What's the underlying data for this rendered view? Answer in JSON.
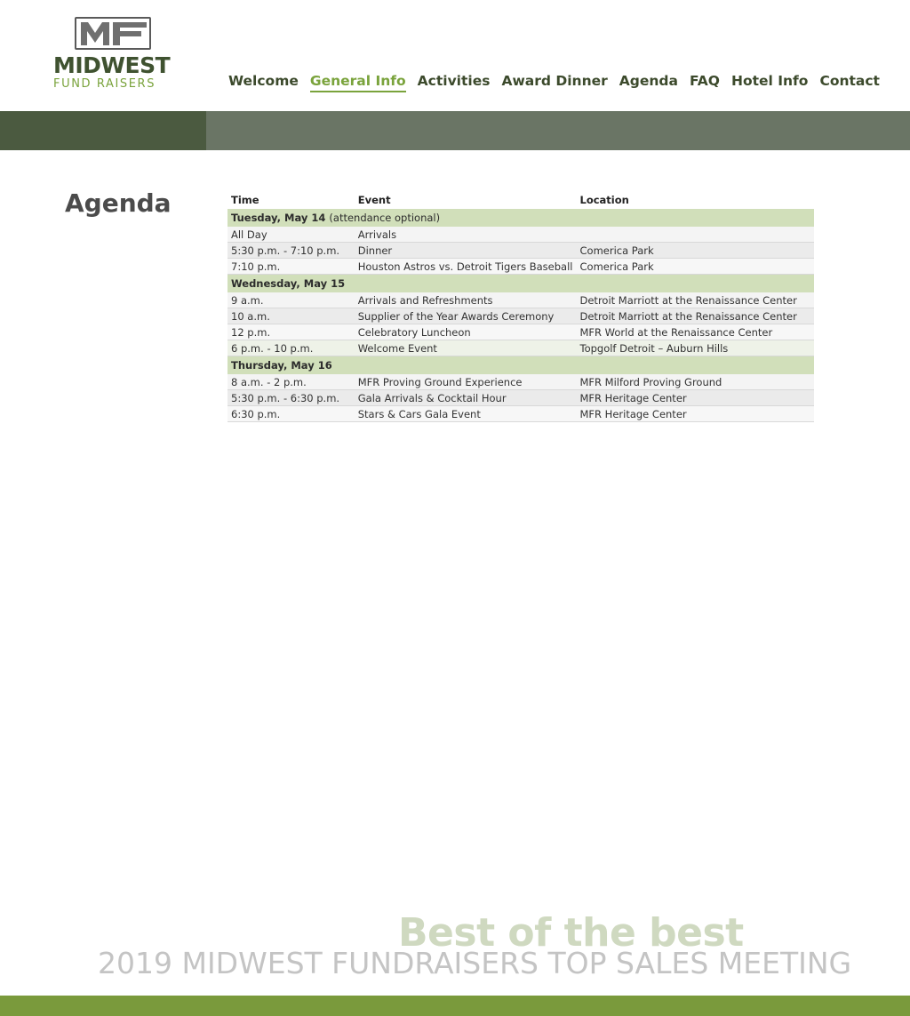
{
  "brand": {
    "mark": "MF",
    "name": "MIDWEST",
    "sub": "FUND RAISERS",
    "colors": {
      "primary": "#3f5230",
      "accent": "#7aa33c",
      "band_dark": "#4b5a40",
      "band_light": "#6a7565",
      "footer": "#7a9a3c",
      "day_row": "#d1dfba"
    }
  },
  "nav": [
    {
      "label": "Welcome",
      "active": false
    },
    {
      "label": "General Info",
      "active": true
    },
    {
      "label": "Activities",
      "active": false
    },
    {
      "label": "Award Dinner",
      "active": false
    },
    {
      "label": "Agenda",
      "active": false
    },
    {
      "label": "FAQ",
      "active": false
    },
    {
      "label": "Hotel Info",
      "active": false
    },
    {
      "label": "Contact",
      "active": false
    }
  ],
  "page": {
    "title": "Agenda"
  },
  "agenda": {
    "headers": [
      "Time",
      "Event",
      "Location"
    ],
    "days": [
      {
        "day": "Tuesday, May 14",
        "note": "(attendance optional)",
        "rows": [
          {
            "time": "All Day",
            "event": "Arrivals",
            "location": ""
          },
          {
            "time": "5:30 p.m. - 7:10 p.m.",
            "event": "Dinner",
            "location": "Comerica Park"
          },
          {
            "time": "7:10 p.m.",
            "event": "Houston Astros vs. Detroit Tigers Baseball",
            "location": "Comerica Park"
          }
        ]
      },
      {
        "day": "Wednesday, May 15",
        "note": "",
        "rows": [
          {
            "time": "9 a.m.",
            "event": "Arrivals and Refreshments",
            "location": "Detroit Marriott at the Renaissance Center"
          },
          {
            "time": "10 a.m.",
            "event": "Supplier of the Year Awards Ceremony",
            "location": "Detroit Marriott at the Renaissance Center"
          },
          {
            "time": "12 p.m.",
            "event": "Celebratory Luncheon",
            "location": "MFR World at the Renaissance Center"
          },
          {
            "time": "6 p.m. - 10 p.m.",
            "event": "Welcome Event",
            "location": "Topgolf Detroit – Auburn Hills"
          }
        ]
      },
      {
        "day": "Thursday, May 16",
        "note": "",
        "rows": [
          {
            "time": "8 a.m. - 2 p.m.",
            "event": "MFR Proving Ground Experience",
            "location": "MFR Milford Proving Ground"
          },
          {
            "time": "5:30 p.m. - 6:30 p.m.",
            "event": "Gala Arrivals & Cocktail Hour",
            "location": "MFR Heritage Center"
          },
          {
            "time": "6:30 p.m.",
            "event": "Stars & Cars Gala Event",
            "location": "MFR Heritage Center"
          }
        ]
      }
    ]
  },
  "footer": {
    "tagline": "Best of the best",
    "meeting": "2019 MIDWEST FUNDRAISERS TOP SALES MEETING"
  }
}
